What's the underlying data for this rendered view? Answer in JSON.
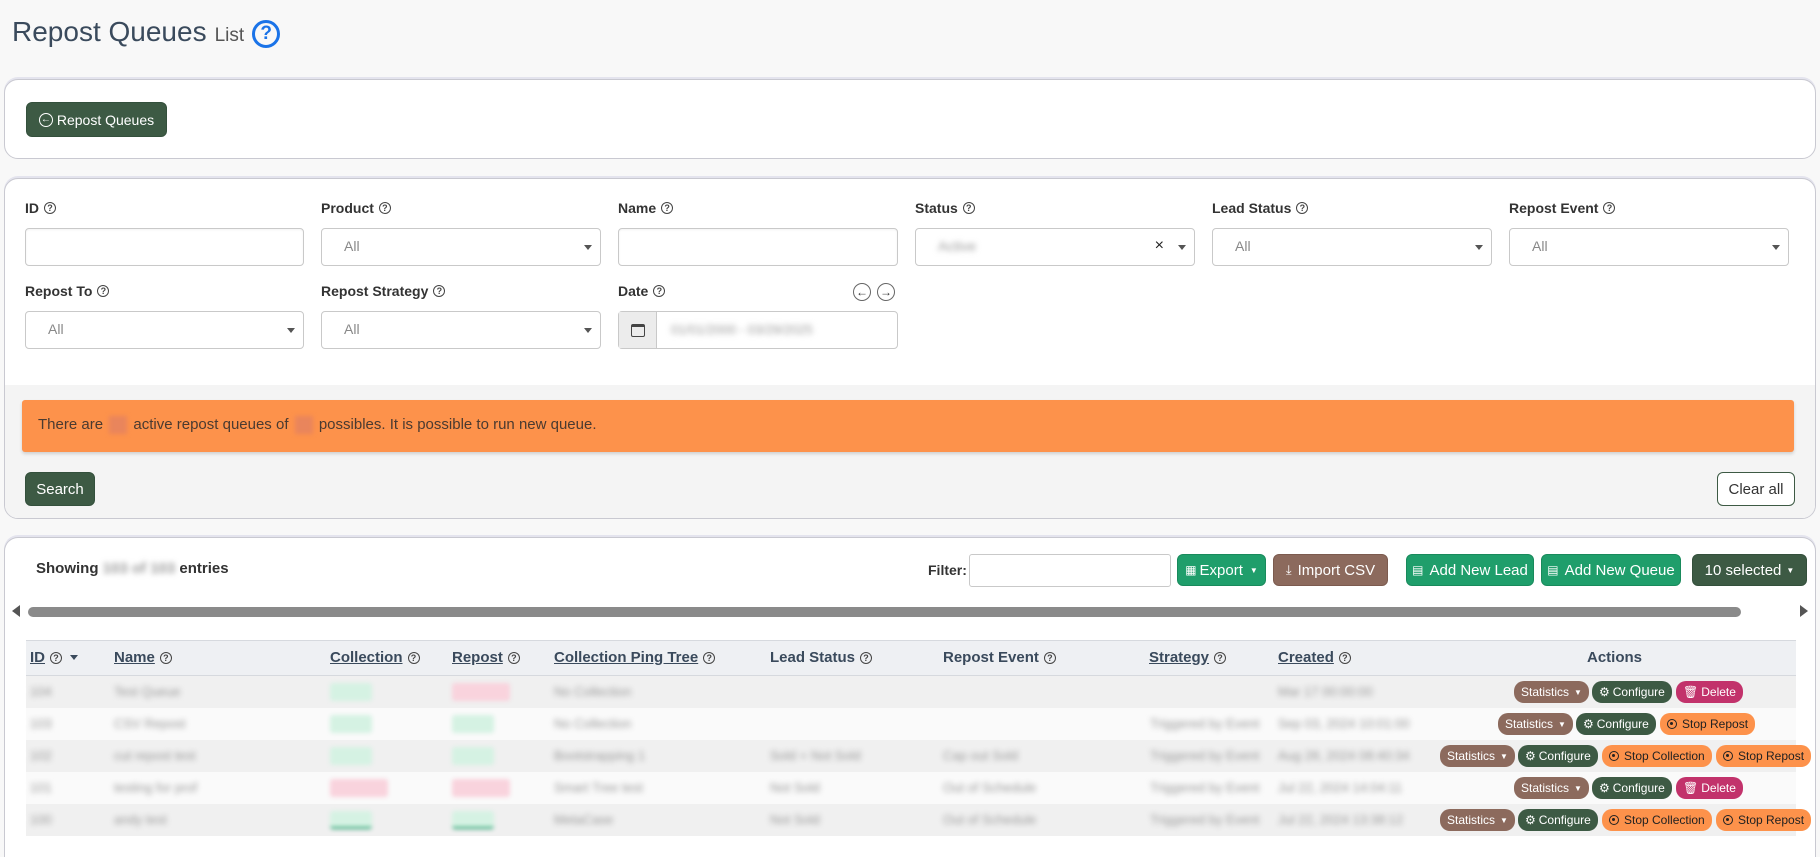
{
  "page": {
    "title": "Repost Queues",
    "subtitle": "List",
    "help_glyph": "?"
  },
  "top_panel": {
    "back_button_label": "Repost Queues"
  },
  "filters": {
    "id": {
      "label": "ID",
      "value": ""
    },
    "product": {
      "label": "Product",
      "value": "All"
    },
    "name": {
      "label": "Name",
      "value": ""
    },
    "status": {
      "label": "Status",
      "value": "Active",
      "clear_glyph": "×"
    },
    "lead_status": {
      "label": "Lead Status",
      "value": "All"
    },
    "repost_event": {
      "label": "Repost Event",
      "value": "All"
    },
    "repost_to": {
      "label": "Repost To",
      "value": "All"
    },
    "repost_strategy": {
      "label": "Repost Strategy",
      "value": "All"
    },
    "date": {
      "label": "Date",
      "value": "01/01/2000 - 03/29/2025"
    }
  },
  "alert": {
    "text_part1": "There are",
    "text_part2": "active repost queues of",
    "text_part3": "possibles. It is possible to run new queue."
  },
  "actions_bar": {
    "search_label": "Search",
    "clear_label": "Clear all"
  },
  "table_toolbar": {
    "showing_prefix": "Showing",
    "showing_count": "103 of 103",
    "showing_suffix": "entries",
    "filter_label": "Filter:",
    "export_label": "Export",
    "import_label": "Import CSV",
    "add_lead_label": "Add New Lead",
    "add_queue_label": "Add New Queue",
    "selected_label": "10 selected"
  },
  "table": {
    "columns": [
      "ID",
      "Name",
      "Collection",
      "Repost",
      "Collection Ping Tree",
      "Lead Status",
      "Repost Event",
      "Strategy",
      "Created",
      "Actions"
    ],
    "rows": [
      {
        "id": "104",
        "name": "Test Queue",
        "collection": "Active",
        "repost": "Disabled",
        "ping_tree": "No Collection",
        "lead_status": "",
        "repost_event": "",
        "strategy": "",
        "created": "Mar 17 00:00:00",
        "actions": [
          "Statistics",
          "Configure",
          "Delete"
        ]
      },
      {
        "id": "103",
        "name": "CSV Repost",
        "collection": "Active",
        "repost": "Active",
        "ping_tree": "No Collection",
        "lead_status": "",
        "repost_event": "",
        "strategy": "Triggered by Event",
        "created": "Sep 03, 2024 10:01:00",
        "actions": [
          "Statistics",
          "Configure",
          "Stop Repost"
        ]
      },
      {
        "id": "102",
        "name": "cut repost test",
        "collection": "Active",
        "repost": "Active",
        "ping_tree": "Bootstrapping 1",
        "lead_status": "Sold + Not Sold",
        "repost_event": "Cap out Sold",
        "strategy": "Triggered by Event",
        "created": "Aug 28, 2024 08:40:34",
        "actions": [
          "Statistics",
          "Configure",
          "Stop Collection",
          "Stop Repost"
        ]
      },
      {
        "id": "101",
        "name": "testing for prof",
        "collection": "Disabled",
        "repost": "Disabled",
        "ping_tree": "Smart Tree test",
        "lead_status": "Not Sold",
        "repost_event": "Out of Schedule",
        "strategy": "Triggered by Event",
        "created": "Jul 22, 2024 14:04:11",
        "actions": [
          "Statistics",
          "Configure",
          "Delete"
        ]
      },
      {
        "id": "100",
        "name": "andy test",
        "collection": "Active",
        "repost": "Active",
        "ping_tree": "MetaCase",
        "lead_status": "Not Sold",
        "repost_event": "Out of Schedule",
        "strategy": "Triggered by Event",
        "created": "Jul 22, 2024 13:38:12",
        "actions": [
          "Statistics",
          "Configure",
          "Stop Collection",
          "Stop Repost"
        ]
      }
    ]
  },
  "colors": {
    "accent_dark_green": "#3d5a44",
    "accent_green": "#1f9e6b",
    "accent_brown": "#8c6a5d",
    "alert_orange": "#fd924b",
    "delete_pink": "#c2326b",
    "help_blue": "#1a73e8"
  }
}
